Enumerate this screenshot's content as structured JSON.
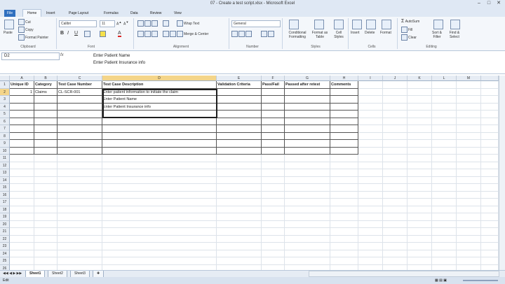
{
  "window": {
    "title": "07 - Create a test script.xlsx - Microsoft Excel"
  },
  "tabs": [
    "File",
    "Home",
    "Insert",
    "Page Layout",
    "Formulas",
    "Data",
    "Review",
    "View"
  ],
  "ribbon": {
    "clipboard": {
      "paste": "Paste",
      "cut": "Cut",
      "copy": "Copy",
      "format_painter": "Format Painter",
      "group": "Clipboard"
    },
    "font": {
      "name": "Calibri",
      "size": "11",
      "group": "Font"
    },
    "alignment": {
      "wrap_text": "Wrap Text",
      "merge_center": "Merge & Center",
      "group": "Alignment"
    },
    "number": {
      "format": "General",
      "group": "Number"
    },
    "styles": {
      "conditional": "Conditional Formatting",
      "format_table": "Format as Table",
      "cell_styles": "Cell Styles",
      "group": "Styles"
    },
    "cells": {
      "insert": "Insert",
      "delete": "Delete",
      "format": "Format",
      "group": "Cells"
    },
    "editing": {
      "autosum": "AutoSum",
      "fill": "Fill",
      "clear": "Clear",
      "sort_filter": "Sort & Filter",
      "find_select": "Find & Select",
      "group": "Editing"
    }
  },
  "formula_bar": {
    "name_box": "D2",
    "fx": "fx",
    "line1": "Enter Patient Name",
    "line2": "Enter Patient Insurance info"
  },
  "columns": [
    "A",
    "B",
    "C",
    "D",
    "E",
    "F",
    "G",
    "H",
    "I",
    "J",
    "K",
    "L",
    "M"
  ],
  "rows": [
    "1",
    "2",
    "3",
    "4",
    "5",
    "6",
    "7",
    "8",
    "9",
    "10",
    "11",
    "12",
    "13",
    "14",
    "15",
    "16",
    "17",
    "18",
    "19",
    "20",
    "21",
    "22",
    "23",
    "24",
    "25",
    "26"
  ],
  "headers": [
    "Unique ID",
    "Category",
    "Test Case Number",
    "Test Case Description",
    "Validation Criteria",
    "Pass/Fail",
    "Passed after retest",
    "Comments"
  ],
  "row2": {
    "id": "1",
    "category": "Claims",
    "number": "CL-SCR-001",
    "desc": "Enter patient information to initiate the claim"
  },
  "row3": {
    "desc": "Enter Patient Name"
  },
  "row4": {
    "desc": "Enter Patient Insurance info"
  },
  "sheets": [
    "Sheet1",
    "Sheet2",
    "Sheet3"
  ],
  "status": {
    "mode": "Edit"
  }
}
